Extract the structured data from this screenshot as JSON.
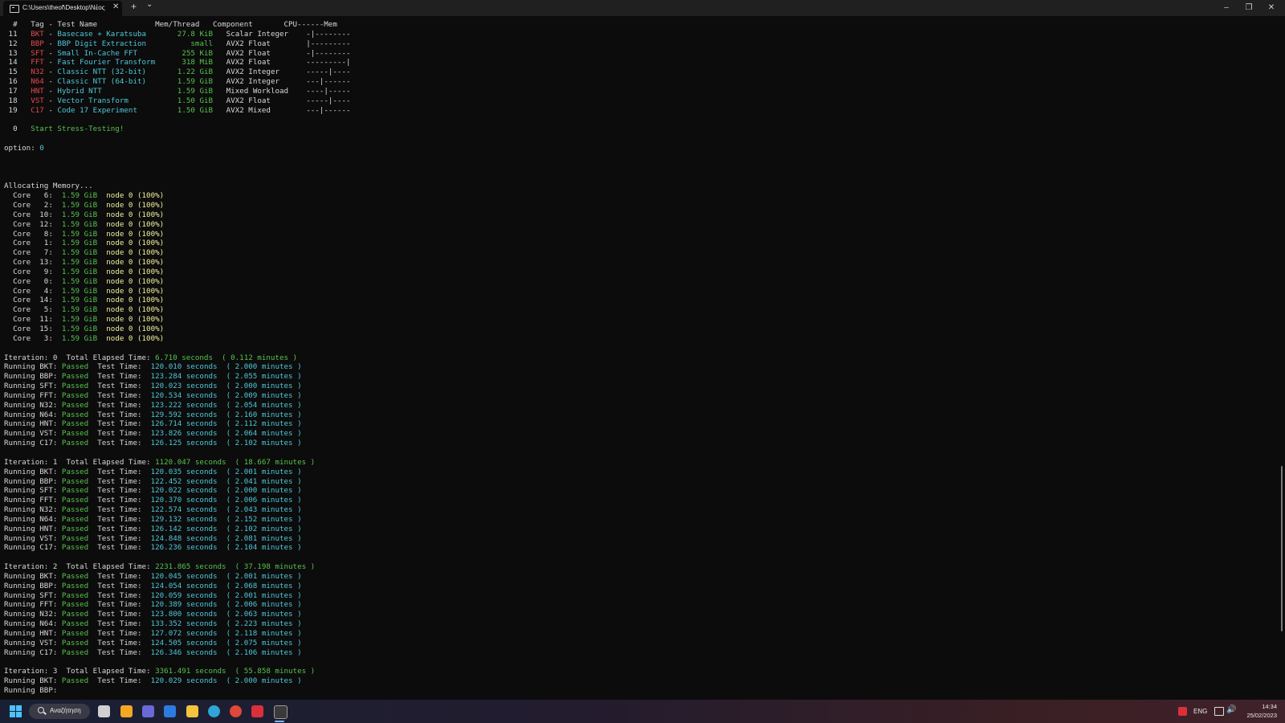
{
  "window": {
    "tab_title": "C:\\Users\\theof\\Desktop\\Νέος",
    "tab_close": "✕",
    "new_tab": "+",
    "dropdown": "⌄",
    "minimize": "–",
    "restore": "❐",
    "close": "✕"
  },
  "lines": [
    [
      [
        "  #   Tag - Test Name             Mem/Thread   Component       CPU------Mem",
        "w"
      ]
    ],
    [
      [
        " 11   ",
        "w"
      ],
      [
        "BKT",
        "r"
      ],
      [
        " - ",
        "w"
      ],
      [
        "Basecase + Karatsuba       ",
        "c"
      ],
      [
        "27.8 KiB",
        "g"
      ],
      [
        "   Scalar Integer    -|--------",
        "w"
      ]
    ],
    [
      [
        " 12   ",
        "w"
      ],
      [
        "BBP",
        "r"
      ],
      [
        " - ",
        "w"
      ],
      [
        "BBP Digit Extraction          ",
        "c"
      ],
      [
        "small",
        "g"
      ],
      [
        "   AVX2 Float        |---------",
        "w"
      ]
    ],
    [
      [
        " 13   ",
        "w"
      ],
      [
        "SFT",
        "r"
      ],
      [
        " - ",
        "w"
      ],
      [
        "Small In-Cache FFT          ",
        "c"
      ],
      [
        "255 KiB",
        "g"
      ],
      [
        "   AVX2 Float        -|--------",
        "w"
      ]
    ],
    [
      [
        " 14   ",
        "w"
      ],
      [
        "FFT",
        "r"
      ],
      [
        " - ",
        "w"
      ],
      [
        "Fast Fourier Transform      ",
        "c"
      ],
      [
        "318 MiB",
        "g"
      ],
      [
        "   AVX2 Float        ---------|",
        "w"
      ]
    ],
    [
      [
        " 15   ",
        "w"
      ],
      [
        "N32",
        "r"
      ],
      [
        " - ",
        "w"
      ],
      [
        "Classic NTT (32-bit)       ",
        "c"
      ],
      [
        "1.22 GiB",
        "g"
      ],
      [
        "   AVX2 Integer      -----|----",
        "w"
      ]
    ],
    [
      [
        " 16   ",
        "w"
      ],
      [
        "N64",
        "r"
      ],
      [
        " - ",
        "w"
      ],
      [
        "Classic NTT (64-bit)       ",
        "c"
      ],
      [
        "1.59 GiB",
        "g"
      ],
      [
        "   AVX2 Integer      ---|------",
        "w"
      ]
    ],
    [
      [
        " 17   ",
        "w"
      ],
      [
        "HNT",
        "r"
      ],
      [
        " - ",
        "w"
      ],
      [
        "Hybrid NTT                 ",
        "c"
      ],
      [
        "1.59 GiB",
        "g"
      ],
      [
        "   Mixed Workload    ----|-----",
        "w"
      ]
    ],
    [
      [
        " 18   ",
        "w"
      ],
      [
        "VST",
        "r"
      ],
      [
        " - ",
        "w"
      ],
      [
        "Vector Transform           ",
        "c"
      ],
      [
        "1.50 GiB",
        "g"
      ],
      [
        "   AVX2 Float        -----|----",
        "w"
      ]
    ],
    [
      [
        " 19   ",
        "w"
      ],
      [
        "C17",
        "r"
      ],
      [
        " - ",
        "w"
      ],
      [
        "Code 17 Experiment         ",
        "c"
      ],
      [
        "1.50 GiB",
        "g"
      ],
      [
        "   AVX2 Mixed        ---|------",
        "w"
      ]
    ],
    [
      [
        "",
        "w"
      ]
    ],
    [
      [
        "  0   ",
        "w"
      ],
      [
        "Start Stress-Testing!",
        "g"
      ]
    ],
    [
      [
        "",
        "w"
      ]
    ],
    [
      [
        "option: ",
        "w"
      ],
      [
        "0",
        "c"
      ]
    ],
    [
      [
        "",
        "w"
      ]
    ],
    [
      [
        "",
        "w"
      ]
    ],
    [
      [
        "",
        "w"
      ]
    ],
    [
      [
        "Allocating Memory...",
        "w"
      ]
    ],
    [
      [
        "  Core   6:  ",
        "w"
      ],
      [
        "1.59 GiB",
        "g"
      ],
      [
        "  ",
        "w"
      ],
      [
        "node 0 (100%)",
        "y"
      ]
    ],
    [
      [
        "  Core   2:  ",
        "w"
      ],
      [
        "1.59 GiB",
        "g"
      ],
      [
        "  ",
        "w"
      ],
      [
        "node 0 (100%)",
        "y"
      ]
    ],
    [
      [
        "  Core  10:  ",
        "w"
      ],
      [
        "1.59 GiB",
        "g"
      ],
      [
        "  ",
        "w"
      ],
      [
        "node 0 (100%)",
        "y"
      ]
    ],
    [
      [
        "  Core  12:  ",
        "w"
      ],
      [
        "1.59 GiB",
        "g"
      ],
      [
        "  ",
        "w"
      ],
      [
        "node 0 (100%)",
        "y"
      ]
    ],
    [
      [
        "  Core   8:  ",
        "w"
      ],
      [
        "1.59 GiB",
        "g"
      ],
      [
        "  ",
        "w"
      ],
      [
        "node 0 (100%)",
        "y"
      ]
    ],
    [
      [
        "  Core   1:  ",
        "w"
      ],
      [
        "1.59 GiB",
        "g"
      ],
      [
        "  ",
        "w"
      ],
      [
        "node 0 (100%)",
        "y"
      ]
    ],
    [
      [
        "  Core   7:  ",
        "w"
      ],
      [
        "1.59 GiB",
        "g"
      ],
      [
        "  ",
        "w"
      ],
      [
        "node 0 (100%)",
        "y"
      ]
    ],
    [
      [
        "  Core  13:  ",
        "w"
      ],
      [
        "1.59 GiB",
        "g"
      ],
      [
        "  ",
        "w"
      ],
      [
        "node 0 (100%)",
        "y"
      ]
    ],
    [
      [
        "  Core   9:  ",
        "w"
      ],
      [
        "1.59 GiB",
        "g"
      ],
      [
        "  ",
        "w"
      ],
      [
        "node 0 (100%)",
        "y"
      ]
    ],
    [
      [
        "  Core   0:  ",
        "w"
      ],
      [
        "1.59 GiB",
        "g"
      ],
      [
        "  ",
        "w"
      ],
      [
        "node 0 (100%)",
        "y"
      ]
    ],
    [
      [
        "  Core   4:  ",
        "w"
      ],
      [
        "1.59 GiB",
        "g"
      ],
      [
        "  ",
        "w"
      ],
      [
        "node 0 (100%)",
        "y"
      ]
    ],
    [
      [
        "  Core  14:  ",
        "w"
      ],
      [
        "1.59 GiB",
        "g"
      ],
      [
        "  ",
        "w"
      ],
      [
        "node 0 (100%)",
        "y"
      ]
    ],
    [
      [
        "  Core   5:  ",
        "w"
      ],
      [
        "1.59 GiB",
        "g"
      ],
      [
        "  ",
        "w"
      ],
      [
        "node 0 (100%)",
        "y"
      ]
    ],
    [
      [
        "  Core  11:  ",
        "w"
      ],
      [
        "1.59 GiB",
        "g"
      ],
      [
        "  ",
        "w"
      ],
      [
        "node 0 (100%)",
        "y"
      ]
    ],
    [
      [
        "  Core  15:  ",
        "w"
      ],
      [
        "1.59 GiB",
        "g"
      ],
      [
        "  ",
        "w"
      ],
      [
        "node 0 (100%)",
        "y"
      ]
    ],
    [
      [
        "  Core   3:  ",
        "w"
      ],
      [
        "1.59 GiB",
        "g"
      ],
      [
        "  ",
        "w"
      ],
      [
        "node 0 (100%)",
        "y"
      ]
    ],
    [
      [
        "",
        "w"
      ]
    ],
    [
      [
        "Iteration: 0  Total Elapsed Time: ",
        "w"
      ],
      [
        "6.710 seconds  ( 0.112 minutes )",
        "g"
      ]
    ],
    [
      [
        "Running BKT: ",
        "w"
      ],
      [
        "Passed",
        "g"
      ],
      [
        "  Test Time:  ",
        "w"
      ],
      [
        "120.010 seconds  ( 2.000 minutes )",
        "c"
      ]
    ],
    [
      [
        "Running BBP: ",
        "w"
      ],
      [
        "Passed",
        "g"
      ],
      [
        "  Test Time:  ",
        "w"
      ],
      [
        "123.284 seconds  ( 2.055 minutes )",
        "c"
      ]
    ],
    [
      [
        "Running SFT: ",
        "w"
      ],
      [
        "Passed",
        "g"
      ],
      [
        "  Test Time:  ",
        "w"
      ],
      [
        "120.023 seconds  ( 2.000 minutes )",
        "c"
      ]
    ],
    [
      [
        "Running FFT: ",
        "w"
      ],
      [
        "Passed",
        "g"
      ],
      [
        "  Test Time:  ",
        "w"
      ],
      [
        "120.534 seconds  ( 2.009 minutes )",
        "c"
      ]
    ],
    [
      [
        "Running N32: ",
        "w"
      ],
      [
        "Passed",
        "g"
      ],
      [
        "  Test Time:  ",
        "w"
      ],
      [
        "123.222 seconds  ( 2.054 minutes )",
        "c"
      ]
    ],
    [
      [
        "Running N64: ",
        "w"
      ],
      [
        "Passed",
        "g"
      ],
      [
        "  Test Time:  ",
        "w"
      ],
      [
        "129.592 seconds  ( 2.160 minutes )",
        "c"
      ]
    ],
    [
      [
        "Running HNT: ",
        "w"
      ],
      [
        "Passed",
        "g"
      ],
      [
        "  Test Time:  ",
        "w"
      ],
      [
        "126.714 seconds  ( 2.112 minutes )",
        "c"
      ]
    ],
    [
      [
        "Running VST: ",
        "w"
      ],
      [
        "Passed",
        "g"
      ],
      [
        "  Test Time:  ",
        "w"
      ],
      [
        "123.826 seconds  ( 2.064 minutes )",
        "c"
      ]
    ],
    [
      [
        "Running C17: ",
        "w"
      ],
      [
        "Passed",
        "g"
      ],
      [
        "  Test Time:  ",
        "w"
      ],
      [
        "126.125 seconds  ( 2.102 minutes )",
        "c"
      ]
    ],
    [
      [
        "",
        "w"
      ]
    ],
    [
      [
        "Iteration: 1  Total Elapsed Time: ",
        "w"
      ],
      [
        "1120.047 seconds  ( 18.667 minutes )",
        "g"
      ]
    ],
    [
      [
        "Running BKT: ",
        "w"
      ],
      [
        "Passed",
        "g"
      ],
      [
        "  Test Time:  ",
        "w"
      ],
      [
        "120.035 seconds  ( 2.001 minutes )",
        "c"
      ]
    ],
    [
      [
        "Running BBP: ",
        "w"
      ],
      [
        "Passed",
        "g"
      ],
      [
        "  Test Time:  ",
        "w"
      ],
      [
        "122.452 seconds  ( 2.041 minutes )",
        "c"
      ]
    ],
    [
      [
        "Running SFT: ",
        "w"
      ],
      [
        "Passed",
        "g"
      ],
      [
        "  Test Time:  ",
        "w"
      ],
      [
        "120.022 seconds  ( 2.000 minutes )",
        "c"
      ]
    ],
    [
      [
        "Running FFT: ",
        "w"
      ],
      [
        "Passed",
        "g"
      ],
      [
        "  Test Time:  ",
        "w"
      ],
      [
        "120.370 seconds  ( 2.006 minutes )",
        "c"
      ]
    ],
    [
      [
        "Running N32: ",
        "w"
      ],
      [
        "Passed",
        "g"
      ],
      [
        "  Test Time:  ",
        "w"
      ],
      [
        "122.574 seconds  ( 2.043 minutes )",
        "c"
      ]
    ],
    [
      [
        "Running N64: ",
        "w"
      ],
      [
        "Passed",
        "g"
      ],
      [
        "  Test Time:  ",
        "w"
      ],
      [
        "129.132 seconds  ( 2.152 minutes )",
        "c"
      ]
    ],
    [
      [
        "Running HNT: ",
        "w"
      ],
      [
        "Passed",
        "g"
      ],
      [
        "  Test Time:  ",
        "w"
      ],
      [
        "126.142 seconds  ( 2.102 minutes )",
        "c"
      ]
    ],
    [
      [
        "Running VST: ",
        "w"
      ],
      [
        "Passed",
        "g"
      ],
      [
        "  Test Time:  ",
        "w"
      ],
      [
        "124.848 seconds  ( 2.081 minutes )",
        "c"
      ]
    ],
    [
      [
        "Running C17: ",
        "w"
      ],
      [
        "Passed",
        "g"
      ],
      [
        "  Test Time:  ",
        "w"
      ],
      [
        "126.236 seconds  ( 2.104 minutes )",
        "c"
      ]
    ],
    [
      [
        "",
        "w"
      ]
    ],
    [
      [
        "Iteration: 2  Total Elapsed Time: ",
        "w"
      ],
      [
        "2231.865 seconds  ( 37.198 minutes )",
        "g"
      ]
    ],
    [
      [
        "Running BKT: ",
        "w"
      ],
      [
        "Passed",
        "g"
      ],
      [
        "  Test Time:  ",
        "w"
      ],
      [
        "120.045 seconds  ( 2.001 minutes )",
        "c"
      ]
    ],
    [
      [
        "Running BBP: ",
        "w"
      ],
      [
        "Passed",
        "g"
      ],
      [
        "  Test Time:  ",
        "w"
      ],
      [
        "124.054 seconds  ( 2.068 minutes )",
        "c"
      ]
    ],
    [
      [
        "Running SFT: ",
        "w"
      ],
      [
        "Passed",
        "g"
      ],
      [
        "  Test Time:  ",
        "w"
      ],
      [
        "120.059 seconds  ( 2.001 minutes )",
        "c"
      ]
    ],
    [
      [
        "Running FFT: ",
        "w"
      ],
      [
        "Passed",
        "g"
      ],
      [
        "  Test Time:  ",
        "w"
      ],
      [
        "120.389 seconds  ( 2.006 minutes )",
        "c"
      ]
    ],
    [
      [
        "Running N32: ",
        "w"
      ],
      [
        "Passed",
        "g"
      ],
      [
        "  Test Time:  ",
        "w"
      ],
      [
        "123.800 seconds  ( 2.063 minutes )",
        "c"
      ]
    ],
    [
      [
        "Running N64: ",
        "w"
      ],
      [
        "Passed",
        "g"
      ],
      [
        "  Test Time:  ",
        "w"
      ],
      [
        "133.352 seconds  ( 2.223 minutes )",
        "c"
      ]
    ],
    [
      [
        "Running HNT: ",
        "w"
      ],
      [
        "Passed",
        "g"
      ],
      [
        "  Test Time:  ",
        "w"
      ],
      [
        "127.072 seconds  ( 2.118 minutes )",
        "c"
      ]
    ],
    [
      [
        "Running VST: ",
        "w"
      ],
      [
        "Passed",
        "g"
      ],
      [
        "  Test Time:  ",
        "w"
      ],
      [
        "124.505 seconds  ( 2.075 minutes )",
        "c"
      ]
    ],
    [
      [
        "Running C17: ",
        "w"
      ],
      [
        "Passed",
        "g"
      ],
      [
        "  Test Time:  ",
        "w"
      ],
      [
        "126.346 seconds  ( 2.106 minutes )",
        "c"
      ]
    ],
    [
      [
        "",
        "w"
      ]
    ],
    [
      [
        "Iteration: 3  Total Elapsed Time: ",
        "w"
      ],
      [
        "3361.491 seconds  ( 55.858 minutes )",
        "g"
      ]
    ],
    [
      [
        "Running BKT: ",
        "w"
      ],
      [
        "Passed",
        "g"
      ],
      [
        "  Test Time:  ",
        "w"
      ],
      [
        "120.029 seconds  ( 2.000 minutes )",
        "c"
      ]
    ],
    [
      [
        "Running BBP: ",
        "w"
      ]
    ]
  ],
  "taskbar": {
    "search_text": "Αναζήτηση",
    "lang": "ENG",
    "time": "14:34",
    "date": "25/02/2023",
    "icons": [
      {
        "name": "task-view-icon",
        "color": "#d0d0d0"
      },
      {
        "name": "widgets-icon",
        "color": "#f5a623"
      },
      {
        "name": "chat-icon",
        "color": "#6b69d6"
      },
      {
        "name": "store-icon",
        "color": "#2d7be0"
      },
      {
        "name": "file-explorer-icon",
        "color": "#f3c43c"
      },
      {
        "name": "edge-icon",
        "color": "#2fa5d8"
      },
      {
        "name": "chrome-icon",
        "color": "#e0483a"
      },
      {
        "name": "app-red-icon",
        "color": "#d9303a"
      },
      {
        "name": "terminal-icon",
        "color": "#3a3a3a"
      }
    ]
  }
}
